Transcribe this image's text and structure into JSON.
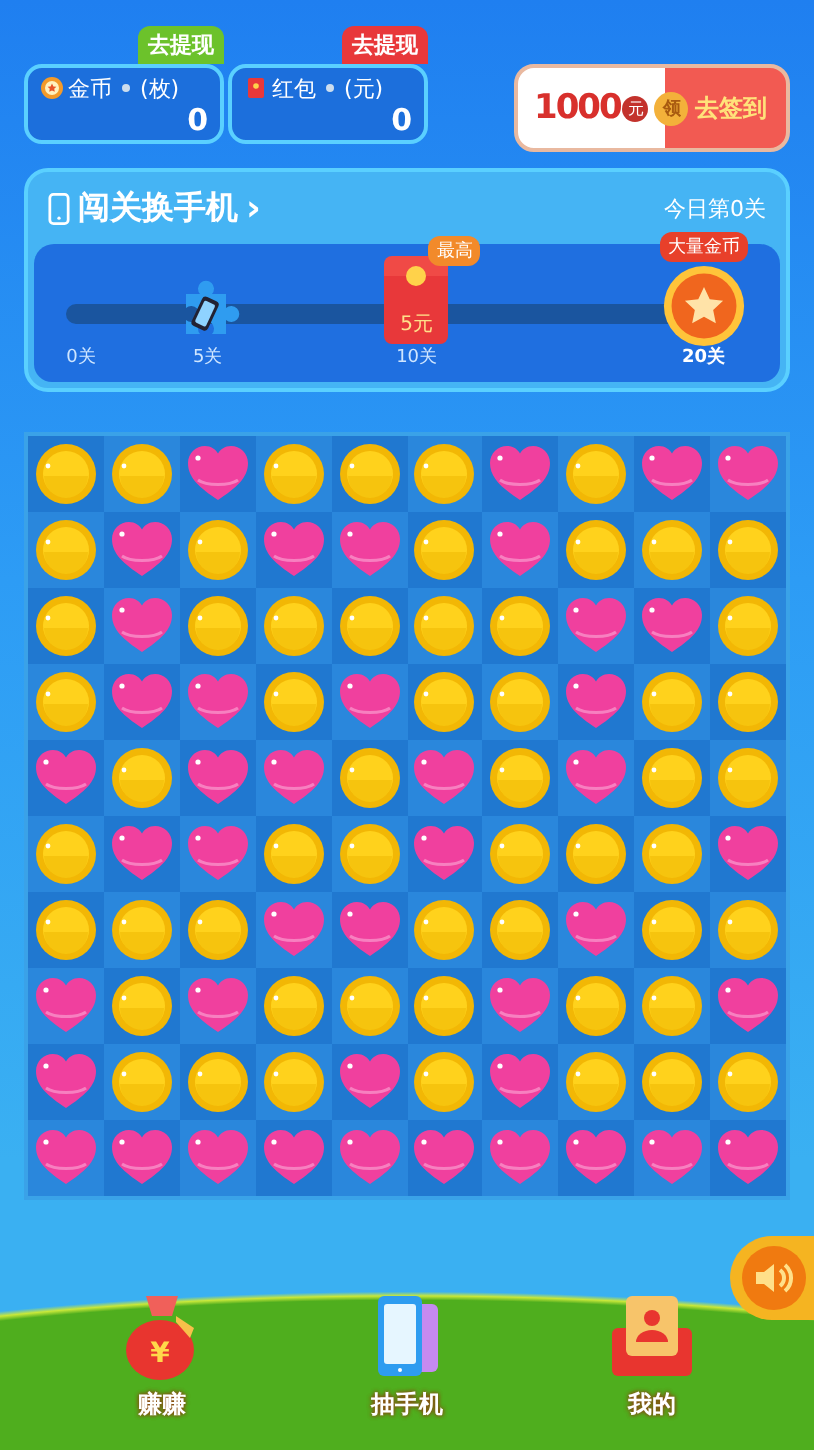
{
  "wallet": [
    {
      "kind": "coin",
      "badge": "去提现",
      "label": "金币",
      "unit": "(枚)",
      "value": "0"
    },
    {
      "kind": "red-packet",
      "badge": "去提现",
      "label": "红包",
      "unit": "(元)",
      "value": "0"
    }
  ],
  "sign_in": {
    "amount": "1000",
    "unit": "元",
    "seal": "领",
    "action": "去签到"
  },
  "progress": {
    "title": "闯关换手机",
    "arrow": "›",
    "today": "今日第0关",
    "level": 0,
    "milestones": [
      {
        "kind": "none",
        "label": "0关"
      },
      {
        "kind": "phone-piece",
        "label": "5关"
      },
      {
        "kind": "red-packet",
        "label": "10关",
        "amount": "5元",
        "badge": "最高"
      },
      {
        "kind": "coin-medal",
        "label": "20关",
        "badge": "大量金币"
      }
    ]
  },
  "board": [
    [
      {
        "kind": "coin"
      },
      {
        "kind": "coin"
      },
      {
        "kind": "heart"
      },
      {
        "kind": "coin"
      },
      {
        "kind": "coin"
      },
      {
        "kind": "coin"
      },
      {
        "kind": "heart"
      },
      {
        "kind": "coin"
      },
      {
        "kind": "heart"
      },
      {
        "kind": "heart"
      }
    ],
    [
      {
        "kind": "coin"
      },
      {
        "kind": "heart"
      },
      {
        "kind": "coin"
      },
      {
        "kind": "heart"
      },
      {
        "kind": "heart"
      },
      {
        "kind": "coin"
      },
      {
        "kind": "heart"
      },
      {
        "kind": "coin"
      },
      {
        "kind": "coin"
      },
      {
        "kind": "coin"
      }
    ],
    [
      {
        "kind": "coin"
      },
      {
        "kind": "heart"
      },
      {
        "kind": "coin"
      },
      {
        "kind": "coin"
      },
      {
        "kind": "coin"
      },
      {
        "kind": "coin"
      },
      {
        "kind": "coin"
      },
      {
        "kind": "heart"
      },
      {
        "kind": "heart"
      },
      {
        "kind": "coin"
      }
    ],
    [
      {
        "kind": "coin"
      },
      {
        "kind": "heart"
      },
      {
        "kind": "heart"
      },
      {
        "kind": "coin"
      },
      {
        "kind": "heart"
      },
      {
        "kind": "coin"
      },
      {
        "kind": "coin"
      },
      {
        "kind": "heart"
      },
      {
        "kind": "coin"
      },
      {
        "kind": "coin"
      }
    ],
    [
      {
        "kind": "heart"
      },
      {
        "kind": "coin"
      },
      {
        "kind": "heart"
      },
      {
        "kind": "heart"
      },
      {
        "kind": "coin"
      },
      {
        "kind": "heart"
      },
      {
        "kind": "coin"
      },
      {
        "kind": "heart"
      },
      {
        "kind": "coin"
      },
      {
        "kind": "coin"
      }
    ],
    [
      {
        "kind": "coin"
      },
      {
        "kind": "heart"
      },
      {
        "kind": "heart"
      },
      {
        "kind": "coin"
      },
      {
        "kind": "coin"
      },
      {
        "kind": "heart"
      },
      {
        "kind": "coin"
      },
      {
        "kind": "coin"
      },
      {
        "kind": "coin"
      },
      {
        "kind": "heart"
      }
    ],
    [
      {
        "kind": "coin"
      },
      {
        "kind": "coin"
      },
      {
        "kind": "coin"
      },
      {
        "kind": "heart"
      },
      {
        "kind": "heart"
      },
      {
        "kind": "coin"
      },
      {
        "kind": "coin"
      },
      {
        "kind": "heart"
      },
      {
        "kind": "coin"
      },
      {
        "kind": "coin"
      }
    ],
    [
      {
        "kind": "heart"
      },
      {
        "kind": "coin"
      },
      {
        "kind": "heart"
      },
      {
        "kind": "coin"
      },
      {
        "kind": "coin"
      },
      {
        "kind": "coin"
      },
      {
        "kind": "heart"
      },
      {
        "kind": "coin"
      },
      {
        "kind": "coin"
      },
      {
        "kind": "heart"
      }
    ],
    [
      {
        "kind": "heart"
      },
      {
        "kind": "coin"
      },
      {
        "kind": "coin"
      },
      {
        "kind": "coin"
      },
      {
        "kind": "heart"
      },
      {
        "kind": "coin"
      },
      {
        "kind": "heart"
      },
      {
        "kind": "coin"
      },
      {
        "kind": "coin"
      },
      {
        "kind": "coin"
      }
    ],
    [
      {
        "kind": "heart"
      },
      {
        "kind": "heart"
      },
      {
        "kind": "heart"
      },
      {
        "kind": "heart"
      },
      {
        "kind": "heart"
      },
      {
        "kind": "heart"
      },
      {
        "kind": "heart"
      },
      {
        "kind": "heart"
      },
      {
        "kind": "heart"
      },
      {
        "kind": "heart"
      }
    ]
  ],
  "sound": {
    "on": true
  },
  "nav": [
    {
      "kind": "money-bag",
      "symbol": "¥",
      "label": "赚赚"
    },
    {
      "kind": "phones",
      "label": "抽手机"
    },
    {
      "kind": "profile",
      "label": "我的"
    }
  ]
}
